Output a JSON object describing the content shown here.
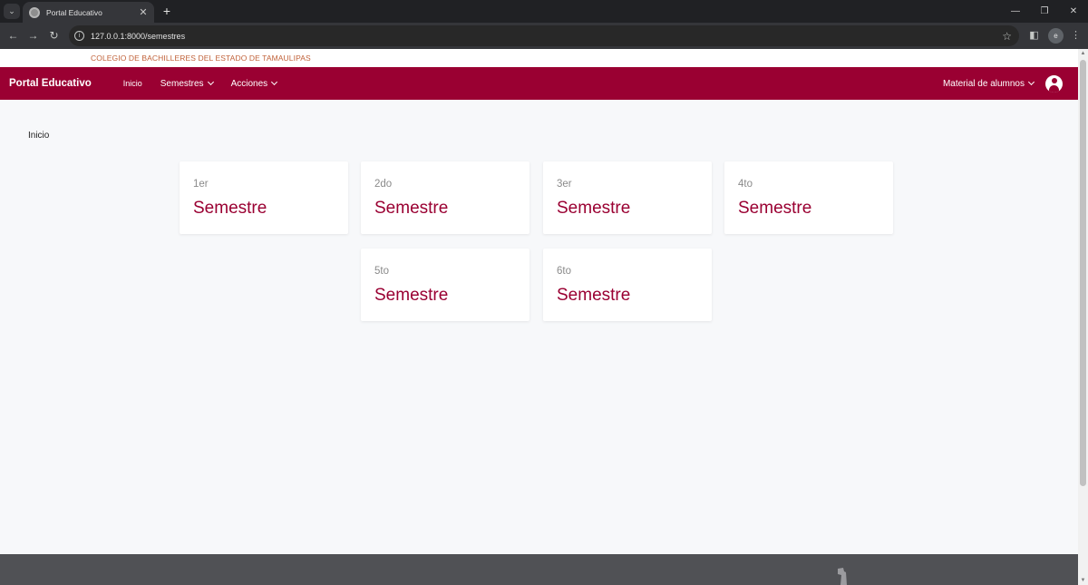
{
  "browser": {
    "tab_title": "Portal Educativo",
    "tab_close": "✕",
    "new_tab": "+",
    "url": "127.0.0.1:8000/semestres",
    "profile_initial": "e"
  },
  "site": {
    "institution": "COLEGIO DE BACHILLERES DEL ESTADO DE TAMAULIPAS",
    "brand": "Portal Educativo"
  },
  "nav": {
    "home": "Inicio",
    "semesters": "Semestres",
    "actions": "Acciones",
    "user_menu": "Material de alumnos"
  },
  "breadcrumb": "Inicio",
  "cards": [
    {
      "num": "1er",
      "title": "Semestre"
    },
    {
      "num": "2do",
      "title": "Semestre"
    },
    {
      "num": "3er",
      "title": "Semestre"
    },
    {
      "num": "4to",
      "title": "Semestre"
    },
    {
      "num": "5to",
      "title": "Semestre"
    },
    {
      "num": "6to",
      "title": "Semestre"
    }
  ],
  "colors": {
    "primary": "#9a0032",
    "institution_text": "#c1623a",
    "page_bg": "#f7f8fa",
    "footer": "#505155"
  },
  "icons": [
    "chevron-down-icon",
    "user-circle-icon",
    "info-icon",
    "star-icon",
    "sidebar-icon",
    "back-icon",
    "forward-icon",
    "reload-icon"
  ]
}
